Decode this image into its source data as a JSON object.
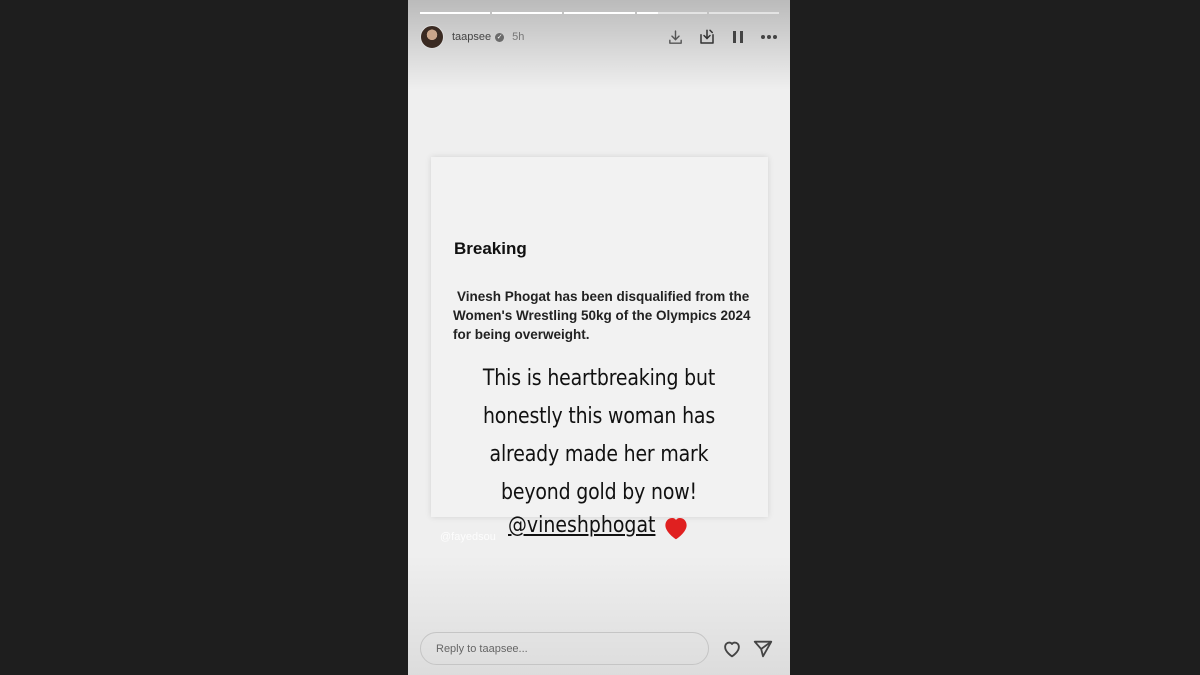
{
  "story": {
    "progress": [
      1.0,
      1.0,
      1.0,
      0.3,
      0.0
    ],
    "user": {
      "username": "taapsee",
      "verified": true,
      "time": "5h"
    },
    "icons": {
      "download": "download-icon",
      "save_to_device": "save-to-device-icon",
      "pause": "pause-icon",
      "more": "more-icon",
      "like": "heart-outline-icon",
      "send": "send-icon"
    }
  },
  "card": {
    "heading": "Breaking",
    "body": "Vinesh Phogat has been disqualified from the Women's Wrestling 50kg of the Olympics 2024 for being overweight."
  },
  "overlay": {
    "text": "This is heartbreaking but honestly this woman has already made her mark beyond gold by now!",
    "mention": "@vineshphogat",
    "ghost_mention": "@fayedsou",
    "emoji": "red-heart-emoji"
  },
  "reply": {
    "placeholder": "Reply to taapsee..."
  },
  "colors": {
    "background": "#1e1e1e",
    "story_bg": "#efefef",
    "heart": "#e02020"
  }
}
